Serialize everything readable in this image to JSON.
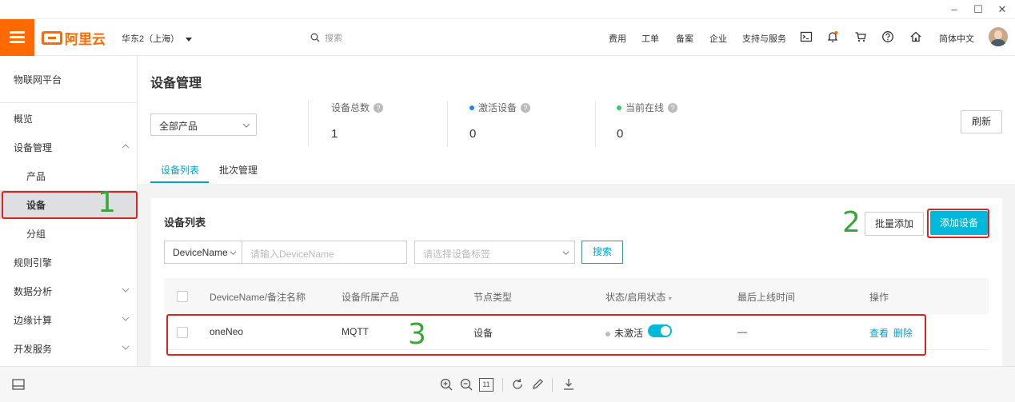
{
  "window": {
    "minimize": "–",
    "maximize": "☐",
    "close": "✕"
  },
  "topnav": {
    "logo_text": "阿里云",
    "region": "华东2（上海）",
    "search_placeholder": "搜索",
    "links": [
      "费用",
      "工单",
      "备案",
      "企业",
      "支持与服务"
    ],
    "language": "简体中文",
    "accent_color": "#ff6a00"
  },
  "sidebar": {
    "title": "物联网平台",
    "items": [
      {
        "label": "概览"
      },
      {
        "label": "设备管理",
        "expanded": true
      },
      {
        "label": "产品"
      },
      {
        "label": "设备",
        "active": true
      },
      {
        "label": "分组"
      },
      {
        "label": "规则引擎"
      },
      {
        "label": "数据分析",
        "expandable": true
      },
      {
        "label": "边缘计算",
        "expandable": true
      },
      {
        "label": "开发服务",
        "expandable": true
      }
    ]
  },
  "main": {
    "title": "设备管理",
    "product_select": "全部产品",
    "stats": [
      {
        "label": "设备总数",
        "value": "1"
      },
      {
        "label": "激活设备",
        "value": "0",
        "dot_color": "#1e88e5"
      },
      {
        "label": "当前在线",
        "value": "0",
        "dot_color": "#2ecc71"
      }
    ],
    "refresh_label": "刷新",
    "tabs": [
      {
        "label": "设备列表",
        "active": true
      },
      {
        "label": "批次管理"
      }
    ]
  },
  "device_list": {
    "title": "设备列表",
    "batch_add_label": "批量添加",
    "add_device_label": "添加设备",
    "filter_type": "DeviceName",
    "filter_placeholder": "请输入DeviceName",
    "tag_placeholder": "请选择设备标签",
    "search_label": "搜索",
    "columns": [
      "DeviceName/备注名称",
      "设备所属产品",
      "节点类型",
      "状态/启用状态",
      "最后上线时间",
      "操作"
    ],
    "rows": [
      {
        "name": "oneNeo",
        "product": "MQTT",
        "node_type": "设备",
        "status": "未激活",
        "enabled": true,
        "last_online": "—",
        "view_label": "查看",
        "delete_label": "删除"
      }
    ]
  },
  "annotations": [
    "1",
    "2",
    "3"
  ],
  "bottom_zoom_label": "11"
}
